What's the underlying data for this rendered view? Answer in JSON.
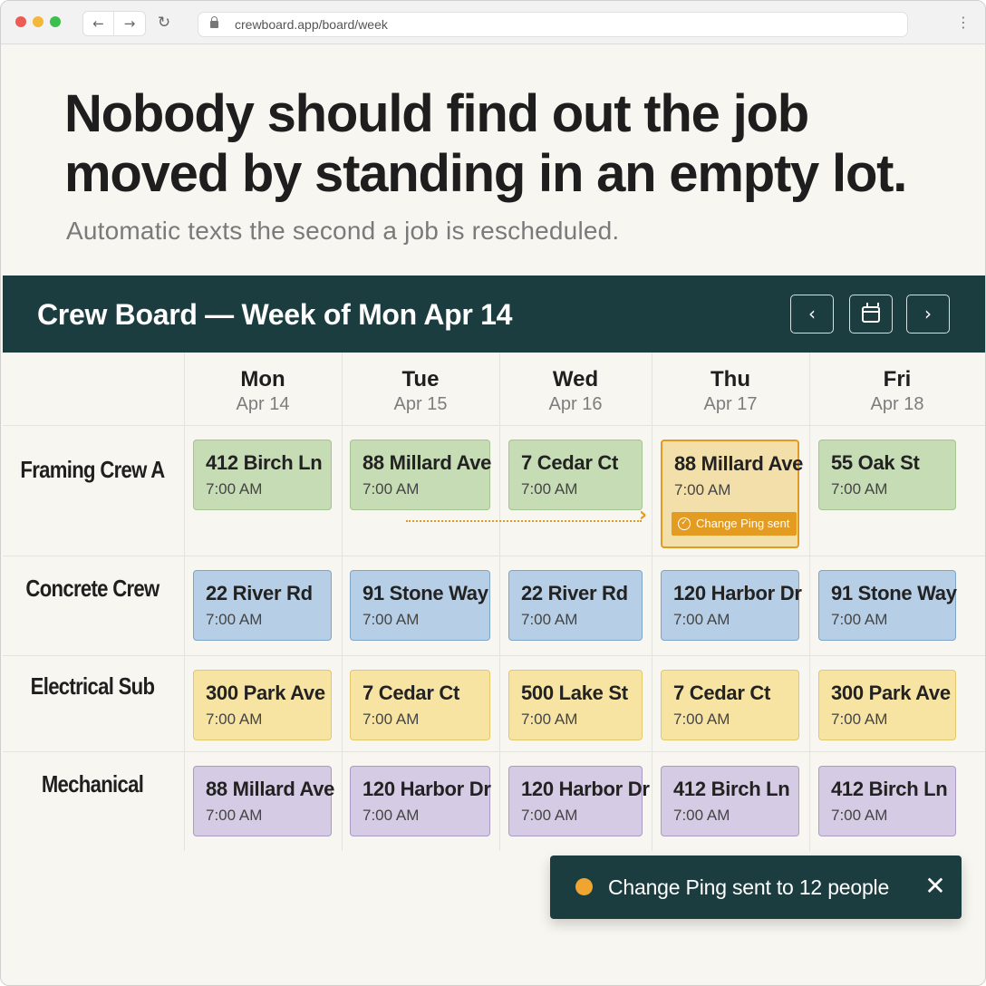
{
  "browser": {
    "url": "crewboard.app/board/week",
    "icons": {
      "back": "back-arrow-icon",
      "forward": "forward-arrow-icon",
      "reload": "reload-icon",
      "lock": "lock-icon",
      "menu": "kebab-menu-icon"
    }
  },
  "hero": {
    "headline": "Nobody should find out the job moved by standing in an empty lot.",
    "subhead": "Automatic texts the second a job is rescheduled."
  },
  "board": {
    "title": "Crew Board — Week of Mon Apr 14",
    "icons": {
      "prev": "chevron-left-icon",
      "calendar": "calendar-icon",
      "next": "chevron-right-icon"
    },
    "days": [
      {
        "name": "Mon",
        "date": "Apr 14"
      },
      {
        "name": "Tue",
        "date": "Apr 15"
      },
      {
        "name": "Wed",
        "date": "Apr 16"
      },
      {
        "name": "Thu",
        "date": "Apr 17"
      },
      {
        "name": "Fri",
        "date": "Apr 18"
      }
    ],
    "crews": [
      {
        "name": "Framing Crew A",
        "color": "#c6dcb5",
        "jobs": [
          {
            "address": "412 Birch Ln",
            "time": "7:00 AM"
          },
          {
            "address": "88 Millard Ave",
            "time": "7:00 AM"
          },
          {
            "address": "7 Cedar Ct",
            "time": "7:00 AM"
          },
          {
            "address": "88 Millard Ave",
            "time": "7:00 AM",
            "badge": "Change Ping sent"
          },
          {
            "address": "55 Oak St",
            "time": "7:00 AM"
          }
        ]
      },
      {
        "name": "Concrete Crew",
        "color": "#b7cfe6",
        "jobs": [
          {
            "address": "22 River Rd",
            "time": "7:00 AM"
          },
          {
            "address": "91 Stone Way",
            "time": "7:00 AM"
          },
          {
            "address": "22 River Rd",
            "time": "7:00 AM"
          },
          {
            "address": "120 Harbor Dr",
            "time": "7:00 AM"
          },
          {
            "address": "91 Stone Way",
            "time": "7:00 AM"
          }
        ]
      },
      {
        "name": "Electrical Sub",
        "color": "#f8e4a2",
        "jobs": [
          {
            "address": "300 Park Ave",
            "time": "7:00 AM"
          },
          {
            "address": "7 Cedar Ct",
            "time": "7:00 AM"
          },
          {
            "address": "500 Lake St",
            "time": "7:00 AM"
          },
          {
            "address": "7 Cedar Ct",
            "time": "7:00 AM"
          },
          {
            "address": "300 Park Ave",
            "time": "7:00 AM"
          }
        ]
      },
      {
        "name": "Mechanical",
        "color": "#d6cbe4",
        "jobs": [
          {
            "address": "88 Millard Ave",
            "time": "7:00 AM"
          },
          {
            "address": "120 Harbor Dr",
            "time": "7:00 AM"
          },
          {
            "address": "120 Harbor Dr",
            "time": "7:00 AM"
          },
          {
            "address": "412 Birch Ln",
            "time": "7:00 AM"
          },
          {
            "address": "412 Birch Ln",
            "time": "7:00 AM"
          }
        ]
      }
    ]
  },
  "toast": {
    "message": "Change Ping sent to 12 people",
    "status_color": "#f0a530",
    "close_icon": "close-icon"
  },
  "colors": {
    "accent": "#e29a22",
    "header_bg": "#1c3d40",
    "page_bg": "#f8f6f0"
  }
}
